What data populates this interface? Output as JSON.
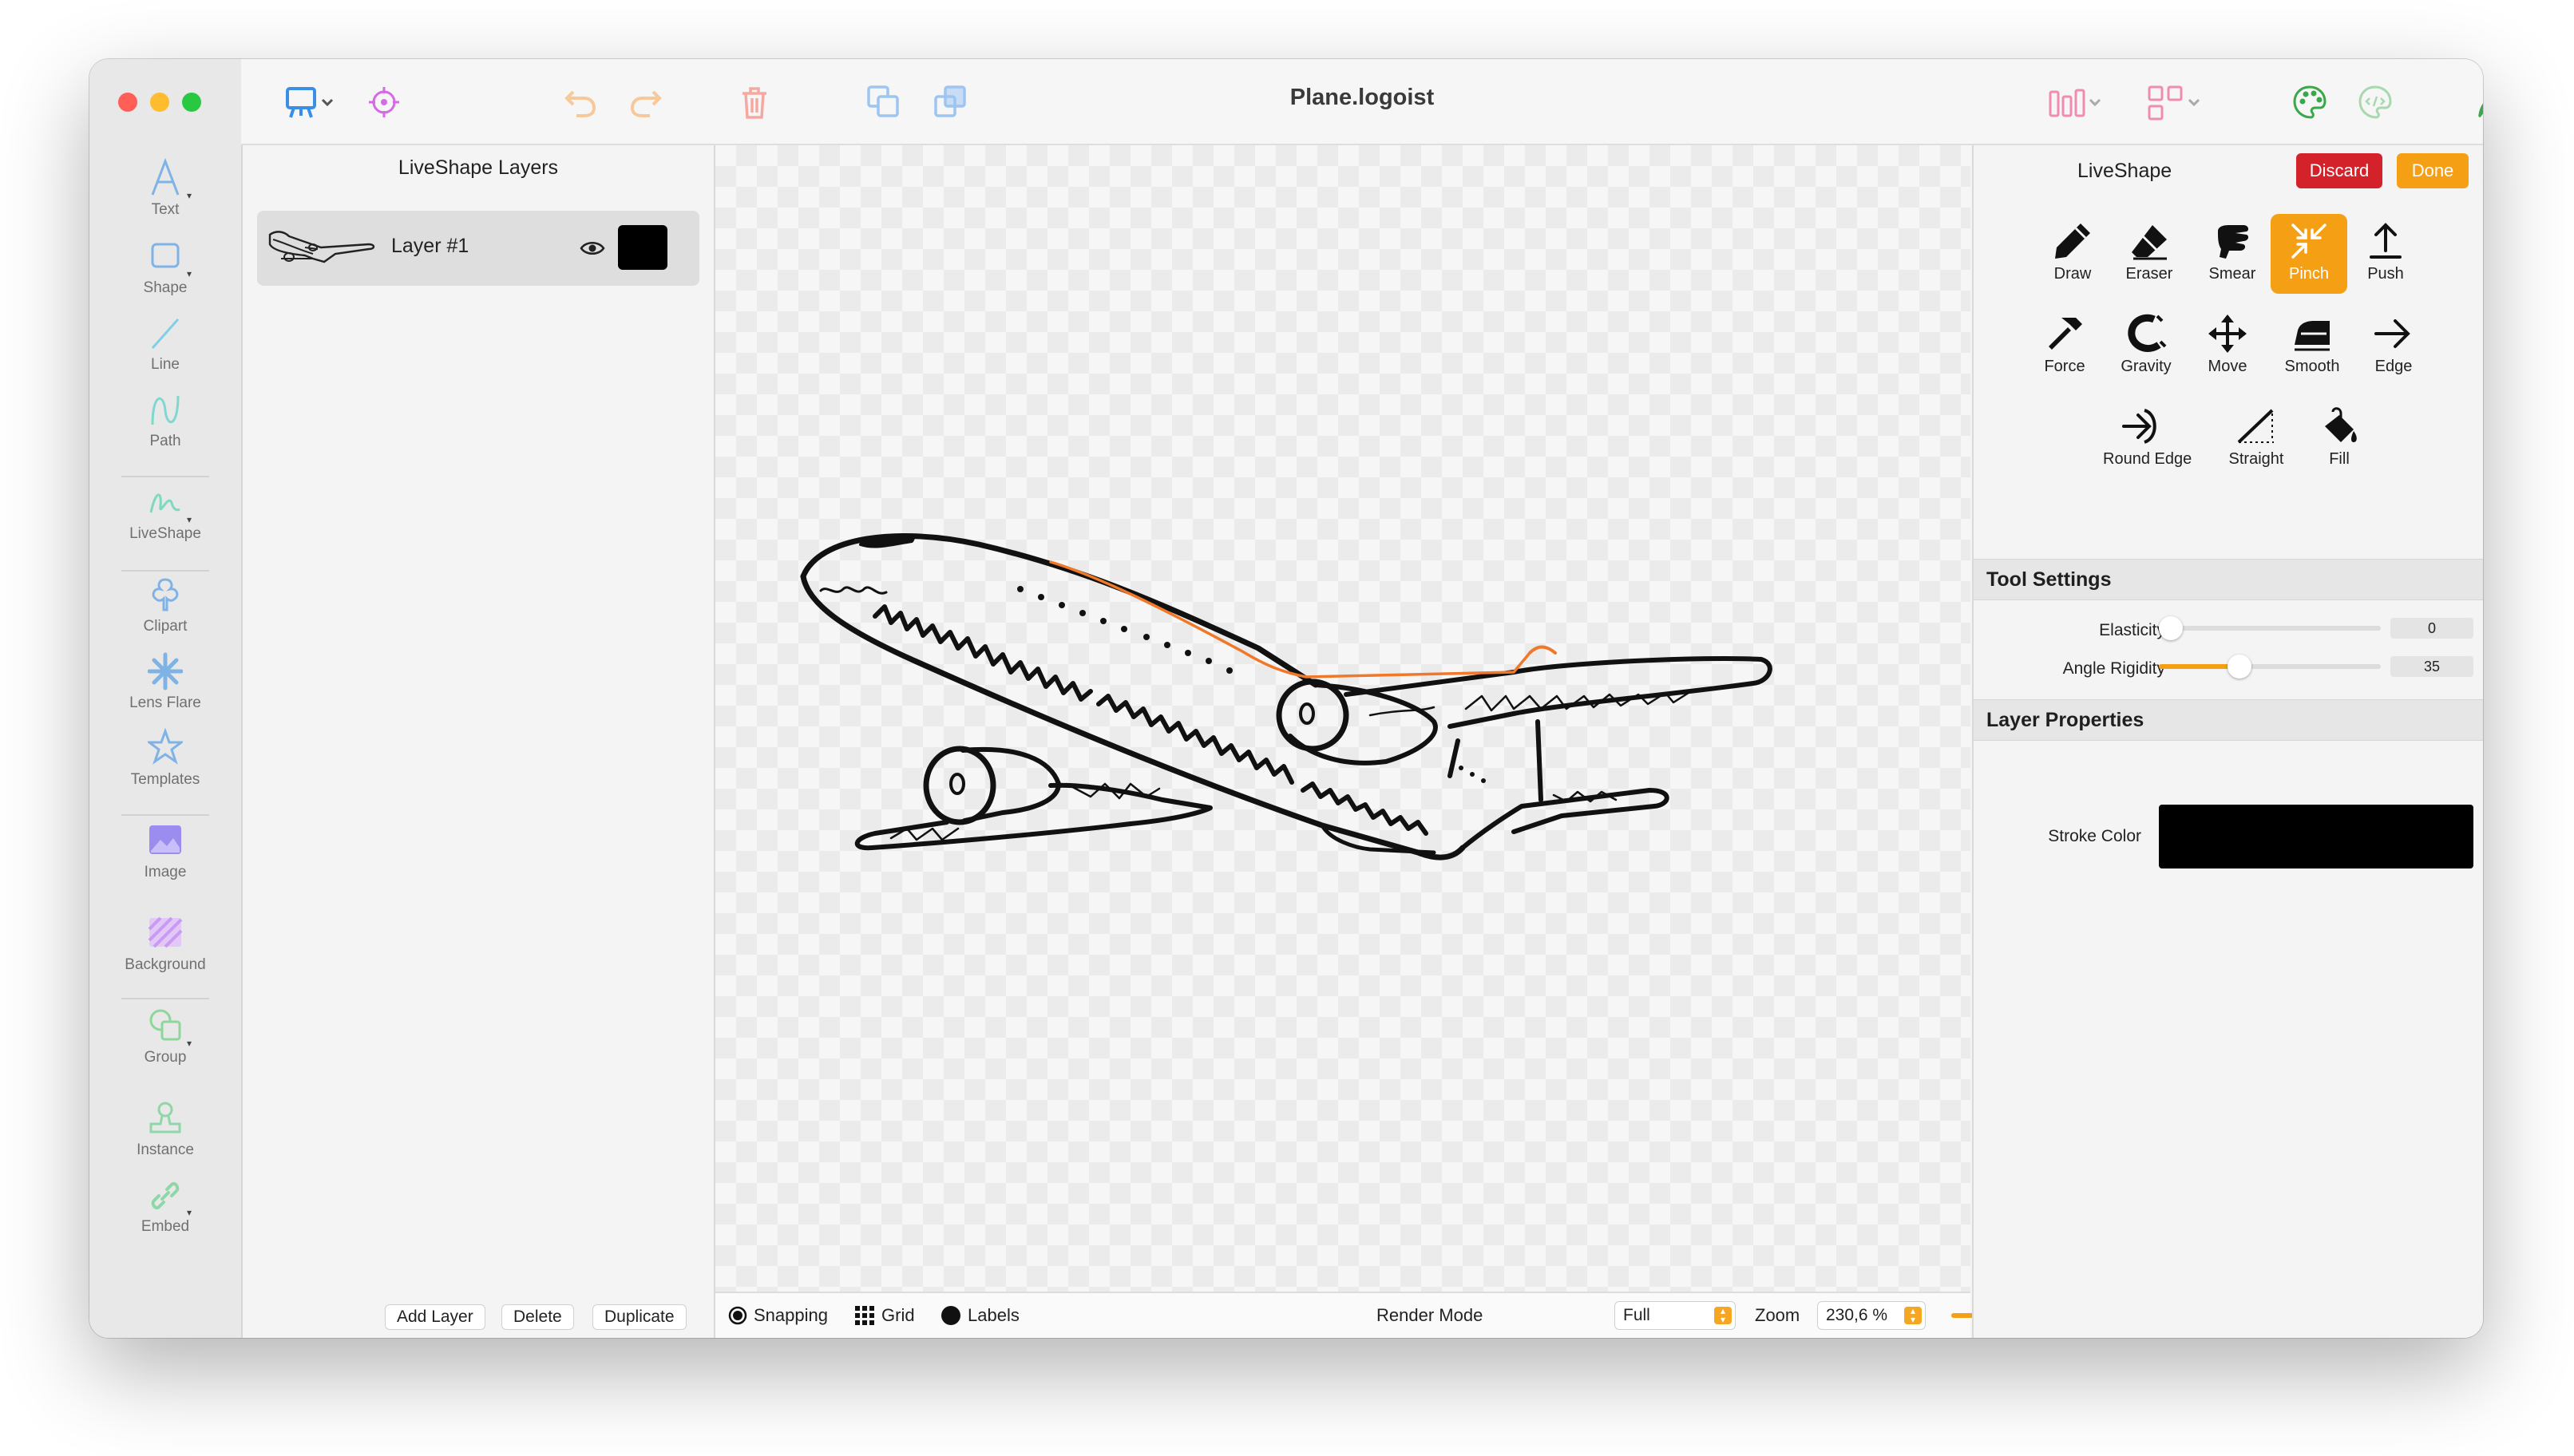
{
  "app": {
    "document_title": "Plane.logoist"
  },
  "sidebar": {
    "items": [
      {
        "label": "Text",
        "icon": "text-icon",
        "color": "#7fb3e6"
      },
      {
        "label": "Shape",
        "icon": "shape-icon",
        "color": "#7fb3e6"
      },
      {
        "label": "Line",
        "icon": "line-icon",
        "color": "#7fd0e6"
      },
      {
        "label": "Path",
        "icon": "path-icon",
        "color": "#7fd8d0"
      },
      {
        "label": "LiveShape",
        "icon": "liveshape-icon",
        "color": "#7fd8c0"
      },
      {
        "label": "Clipart",
        "icon": "clipart-icon",
        "color": "#7fb3e6"
      },
      {
        "label": "Lens Flare",
        "icon": "lens-flare-icon",
        "color": "#7fb3e6"
      },
      {
        "label": "Templates",
        "icon": "templates-icon",
        "color": "#7fb3e6"
      },
      {
        "label": "Image",
        "icon": "image-icon",
        "color": "#9b8cf0"
      },
      {
        "label": "Background",
        "icon": "background-icon",
        "color": "#c79bf0"
      },
      {
        "label": "Group",
        "icon": "group-icon",
        "color": "#8fd69b"
      },
      {
        "label": "Instance",
        "icon": "instance-icon",
        "color": "#8fd6a8"
      },
      {
        "label": "Embed",
        "icon": "embed-icon",
        "color": "#8fd6a8"
      }
    ]
  },
  "layers_panel": {
    "title": "LiveShape Layers",
    "layers": [
      {
        "name": "Layer #1",
        "color": "#000000"
      }
    ],
    "buttons": {
      "add": "Add Layer",
      "delete": "Delete",
      "duplicate": "Duplicate"
    }
  },
  "bottom_bar": {
    "snapping": "Snapping",
    "grid": "Grid",
    "labels": "Labels",
    "render_mode_label": "Render Mode",
    "render_mode_value": "Full",
    "zoom_label": "Zoom",
    "zoom_value": "230,6 %",
    "zoom_slider_fraction": 0.4
  },
  "liveshape_panel": {
    "title": "LiveShape",
    "discard": "Discard",
    "done": "Done",
    "tools": [
      {
        "label": "Draw",
        "icon": "pencil-icon"
      },
      {
        "label": "Eraser",
        "icon": "eraser-icon"
      },
      {
        "label": "Smear",
        "icon": "smear-icon"
      },
      {
        "label": "Pinch",
        "icon": "pinch-icon",
        "active": true
      },
      {
        "label": "Push",
        "icon": "push-icon"
      },
      {
        "label": "Force",
        "icon": "hammer-icon"
      },
      {
        "label": "Gravity",
        "icon": "magnet-icon"
      },
      {
        "label": "Move",
        "icon": "move-icon"
      },
      {
        "label": "Smooth",
        "icon": "iron-icon"
      },
      {
        "label": "Edge",
        "icon": "edge-icon"
      },
      {
        "label": "Round Edge",
        "icon": "round-edge-icon"
      },
      {
        "label": "Straight",
        "icon": "straight-icon"
      },
      {
        "label": "Fill",
        "icon": "fill-bucket-icon"
      }
    ],
    "tool_settings": {
      "title": "Tool Settings",
      "elasticity_label": "Elasticity",
      "elasticity_value": "0",
      "angle_rigidity_label": "Angle Rigidity",
      "angle_rigidity_value": "35"
    },
    "layer_properties": {
      "title": "Layer Properties",
      "stroke_color_label": "Stroke Color",
      "stroke_color": "#000000"
    }
  },
  "colors": {
    "accent": "#f5a014",
    "discard": "#d4222a",
    "toolbar_blue": "#3a8ee6",
    "toolbar_pink": "#f08cb0",
    "toolbar_green": "#3aa84a"
  }
}
